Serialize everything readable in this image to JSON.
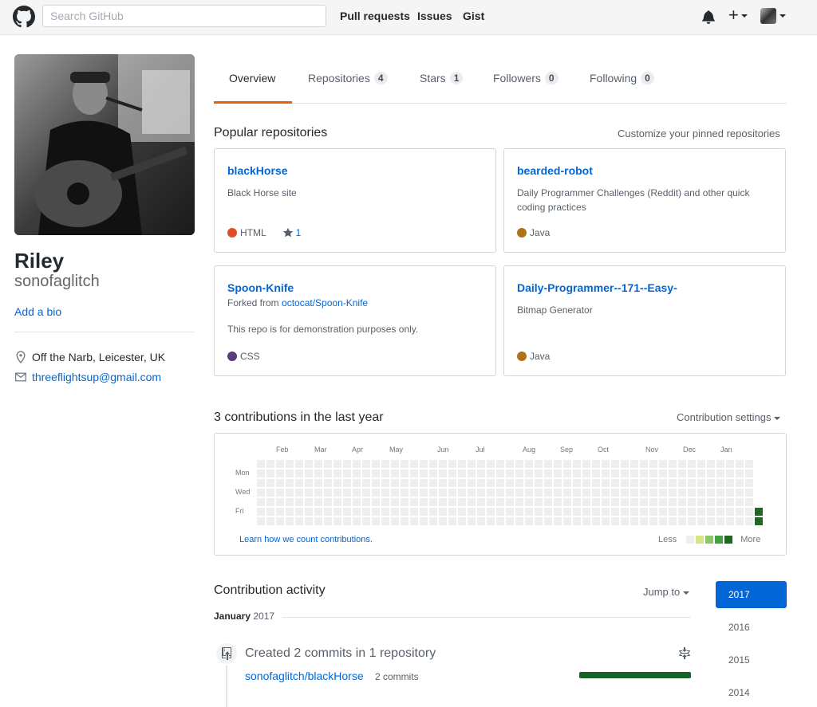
{
  "header": {
    "search_placeholder": "Search GitHub",
    "nav": [
      "Pull requests",
      "Issues",
      "Gist"
    ],
    "plus_label": "+"
  },
  "profile": {
    "name": "Riley",
    "login": "sonofaglitch",
    "add_bio": "Add a bio",
    "location": "Off the Narb, Leicester, UK",
    "email": "threeflightsup@gmail.com"
  },
  "tabs": [
    {
      "label": "Overview",
      "count": null
    },
    {
      "label": "Repositories",
      "count": "4"
    },
    {
      "label": "Stars",
      "count": "1"
    },
    {
      "label": "Followers",
      "count": "0"
    },
    {
      "label": "Following",
      "count": "0"
    }
  ],
  "popular": {
    "title": "Popular repositories",
    "customize": "Customize your pinned repositories",
    "repos": [
      {
        "name": "blackHorse",
        "fork": "",
        "fork_source": "",
        "desc": "Black Horse site",
        "lang": "HTML",
        "lang_color": "#e34c26",
        "stars": "1"
      },
      {
        "name": "bearded-robot",
        "fork": "",
        "fork_source": "",
        "desc": "Daily Programmer Challenges (Reddit) and other quick coding practices",
        "lang": "Java",
        "lang_color": "#b07219",
        "stars": ""
      },
      {
        "name": "Spoon-Knife",
        "fork": "Forked from ",
        "fork_source": "octocat/Spoon-Knife",
        "desc": "This repo is for demonstration purposes only.",
        "lang": "CSS",
        "lang_color": "#563d7c",
        "stars": ""
      },
      {
        "name": "Daily-Programmer--171--Easy-",
        "fork": "",
        "fork_source": "",
        "desc": "Bitmap Generator",
        "lang": "Java",
        "lang_color": "#b07219",
        "stars": ""
      }
    ]
  },
  "contributions": {
    "title": "3 contributions in the last year",
    "settings": "Contribution settings",
    "months": [
      "Feb",
      "Mar",
      "Apr",
      "May",
      "Jun",
      "Jul",
      "Aug",
      "Sep",
      "Oct",
      "Nov",
      "Dec",
      "Jan"
    ],
    "days": [
      "Mon",
      "Wed",
      "Fri"
    ],
    "learn": "Learn how we count contributions.",
    "less": "Less",
    "more": "More",
    "colors": [
      "#eeeeee",
      "#d6e685",
      "#8cc665",
      "#44a340",
      "#1e6823"
    ],
    "active_cells": [
      {
        "week": 52,
        "day": 5,
        "level": 4
      },
      {
        "week": 52,
        "day": 6,
        "level": 4
      }
    ]
  },
  "activity": {
    "title": "Contribution activity",
    "jump_to": "Jump to",
    "years": [
      "2017",
      "2016",
      "2015",
      "2014"
    ],
    "month": "January",
    "year": "2017",
    "event_title": "Created 2 commits in 1 repository",
    "event_repo": "sonofaglitch/blackHorse",
    "event_count": "2 commits"
  }
}
